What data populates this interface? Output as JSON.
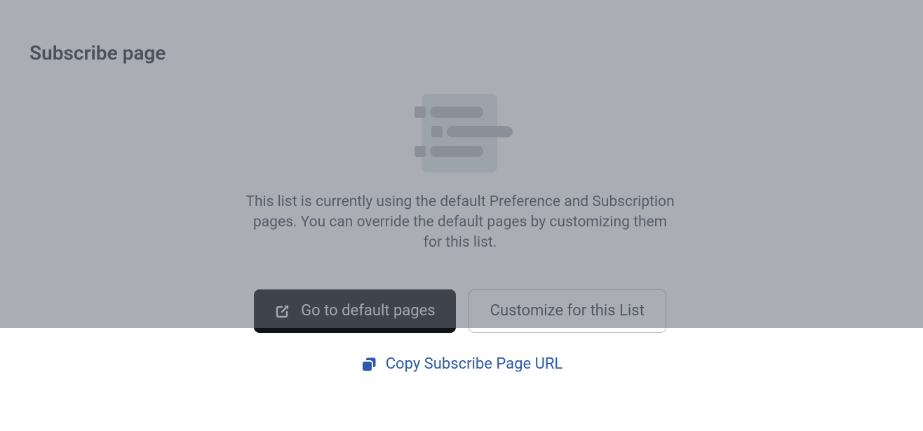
{
  "card": {
    "title": "Subscribe page",
    "description": "This list is currently using the default Preference and Subscription pages. You can override the default pages by customizing them for this list.",
    "primary_button": "Go to default pages",
    "secondary_button": "Customize for this List"
  },
  "copy_link": {
    "label": "Copy Subscribe Page URL"
  }
}
